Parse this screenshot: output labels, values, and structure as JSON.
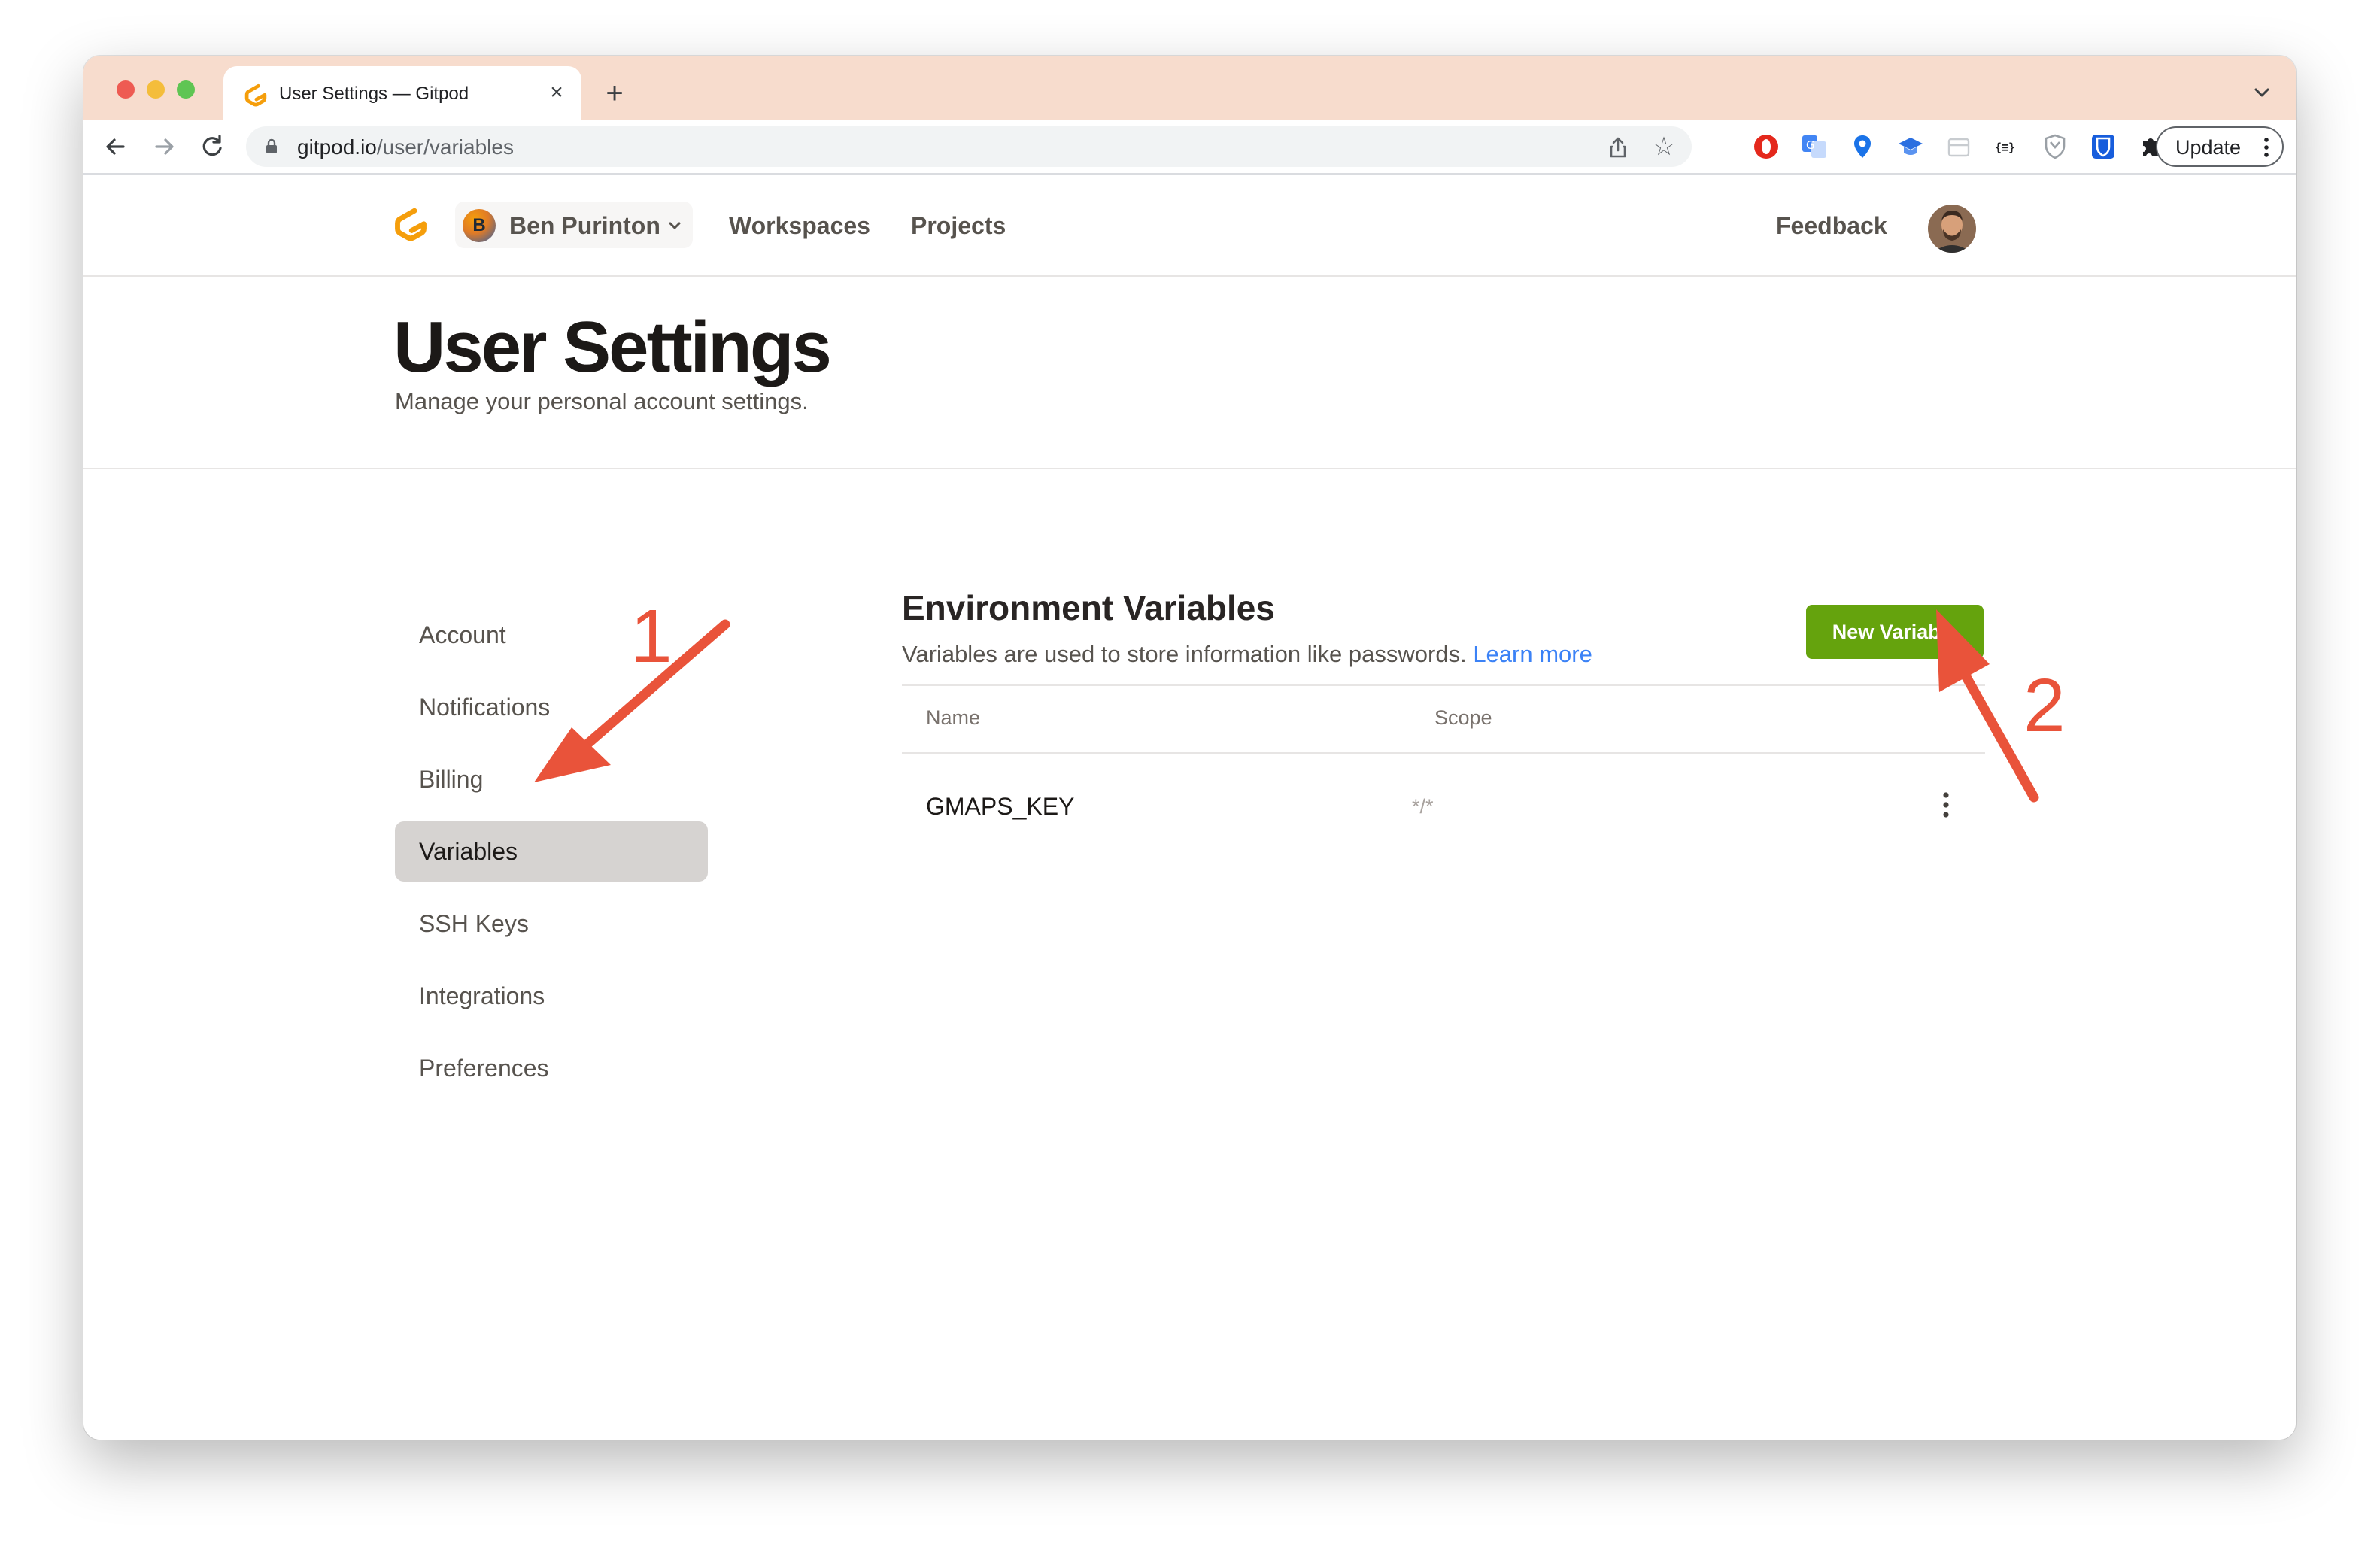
{
  "browser": {
    "tab_title": "User Settings — Gitpod",
    "url_host": "gitpod.io",
    "url_path": "/user/variables",
    "update_label": "Update",
    "new_tab_glyph": "+",
    "close_glyph": "×",
    "star_glyph": "☆",
    "extension_icons": [
      "opera-icon",
      "google-translate-icon",
      "maps-pin-icon",
      "graduation-cap-icon",
      "page-icon",
      "json-viewer-icon",
      "shield-icon",
      "bitwarden-icon",
      "puzzle-extensions-icon",
      "side-panel-icon",
      "profile-avatar-icon"
    ]
  },
  "app": {
    "org_name": "Ben Purinton",
    "org_initial": "B",
    "nav": {
      "workspaces": "Workspaces",
      "projects": "Projects",
      "feedback": "Feedback"
    }
  },
  "header": {
    "title": "User Settings",
    "subtitle": "Manage your personal account settings."
  },
  "sidebar": {
    "items": [
      {
        "label": "Account",
        "active": false
      },
      {
        "label": "Notifications",
        "active": false
      },
      {
        "label": "Billing",
        "active": false
      },
      {
        "label": "Variables",
        "active": true
      },
      {
        "label": "SSH Keys",
        "active": false
      },
      {
        "label": "Integrations",
        "active": false
      },
      {
        "label": "Preferences",
        "active": false
      }
    ]
  },
  "variables": {
    "title": "Environment Variables",
    "description": "Variables are used to store information like passwords.",
    "learn_more": "Learn more",
    "new_button": "New Variable",
    "columns": {
      "name": "Name",
      "scope": "Scope"
    },
    "rows": [
      {
        "name": "GMAPS_KEY",
        "scope": "*/*"
      }
    ]
  },
  "annotations": {
    "label_1": "1",
    "label_2": "2",
    "arrow_color": "#e9533a"
  },
  "colors": {
    "tabstrip": "#f7dccd",
    "accent_green": "#65a30d",
    "link_blue": "#3b82f6",
    "gitpod_orange": "#f59e0b"
  }
}
